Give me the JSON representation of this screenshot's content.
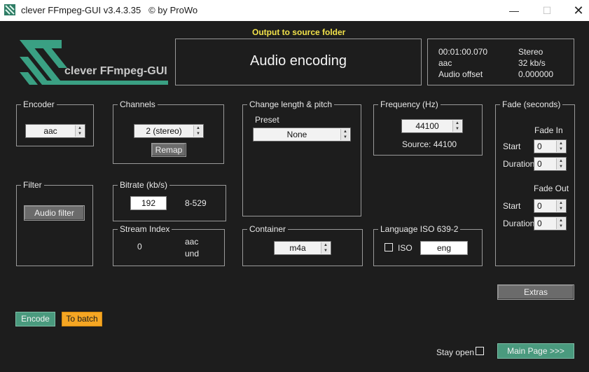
{
  "window": {
    "title": "clever FFmpeg-GUI v3.4.3.35   © by ProWo",
    "min_icon": "minimize-icon",
    "max_icon": "maximize-icon",
    "close_icon": "close-icon"
  },
  "header": {
    "output_label": "Output to source folder",
    "logo_text": "clever FFmpeg-GUI",
    "mode_title": "Audio encoding",
    "info": {
      "duration": "00:01:00.070",
      "channels_mode": "Stereo",
      "codec": "aac",
      "bitrate": "32 kb/s",
      "offset_label": "Audio offset",
      "offset_value": "0.000000"
    }
  },
  "encoder": {
    "label": "Encoder",
    "value": "aac"
  },
  "channels": {
    "label": "Channels",
    "value": "2 (stereo)",
    "remap_button": "Remap"
  },
  "change_length": {
    "label": "Change length & pitch",
    "preset_label": "Preset",
    "preset_value": "None"
  },
  "frequency": {
    "label": "Frequency (Hz)",
    "value": "44100",
    "source": "Source: 44100"
  },
  "fade": {
    "label": "Fade (seconds)",
    "fade_in_label": "Fade In",
    "fade_out_label": "Fade Out",
    "start_label": "Start",
    "duration_label": "Duration",
    "in_start": "0",
    "in_duration": "0",
    "out_start": "0",
    "out_duration": "0"
  },
  "filter": {
    "label": "Filter",
    "button": "Audio filter"
  },
  "bitrate": {
    "label": "Bitrate (kb/s)",
    "value": "192",
    "range": "8-529"
  },
  "stream_index": {
    "label": "Stream Index",
    "value": "0",
    "codec": "aac",
    "lang": "und"
  },
  "container": {
    "label": "Container",
    "value": "m4a"
  },
  "language": {
    "label": "Language ISO 639-2",
    "iso_label": "ISO",
    "value": "eng"
  },
  "buttons": {
    "extras": "Extras",
    "encode": "Encode",
    "to_batch": "To batch",
    "stay_open": "Stay open",
    "main_page": "Main Page >>>"
  }
}
